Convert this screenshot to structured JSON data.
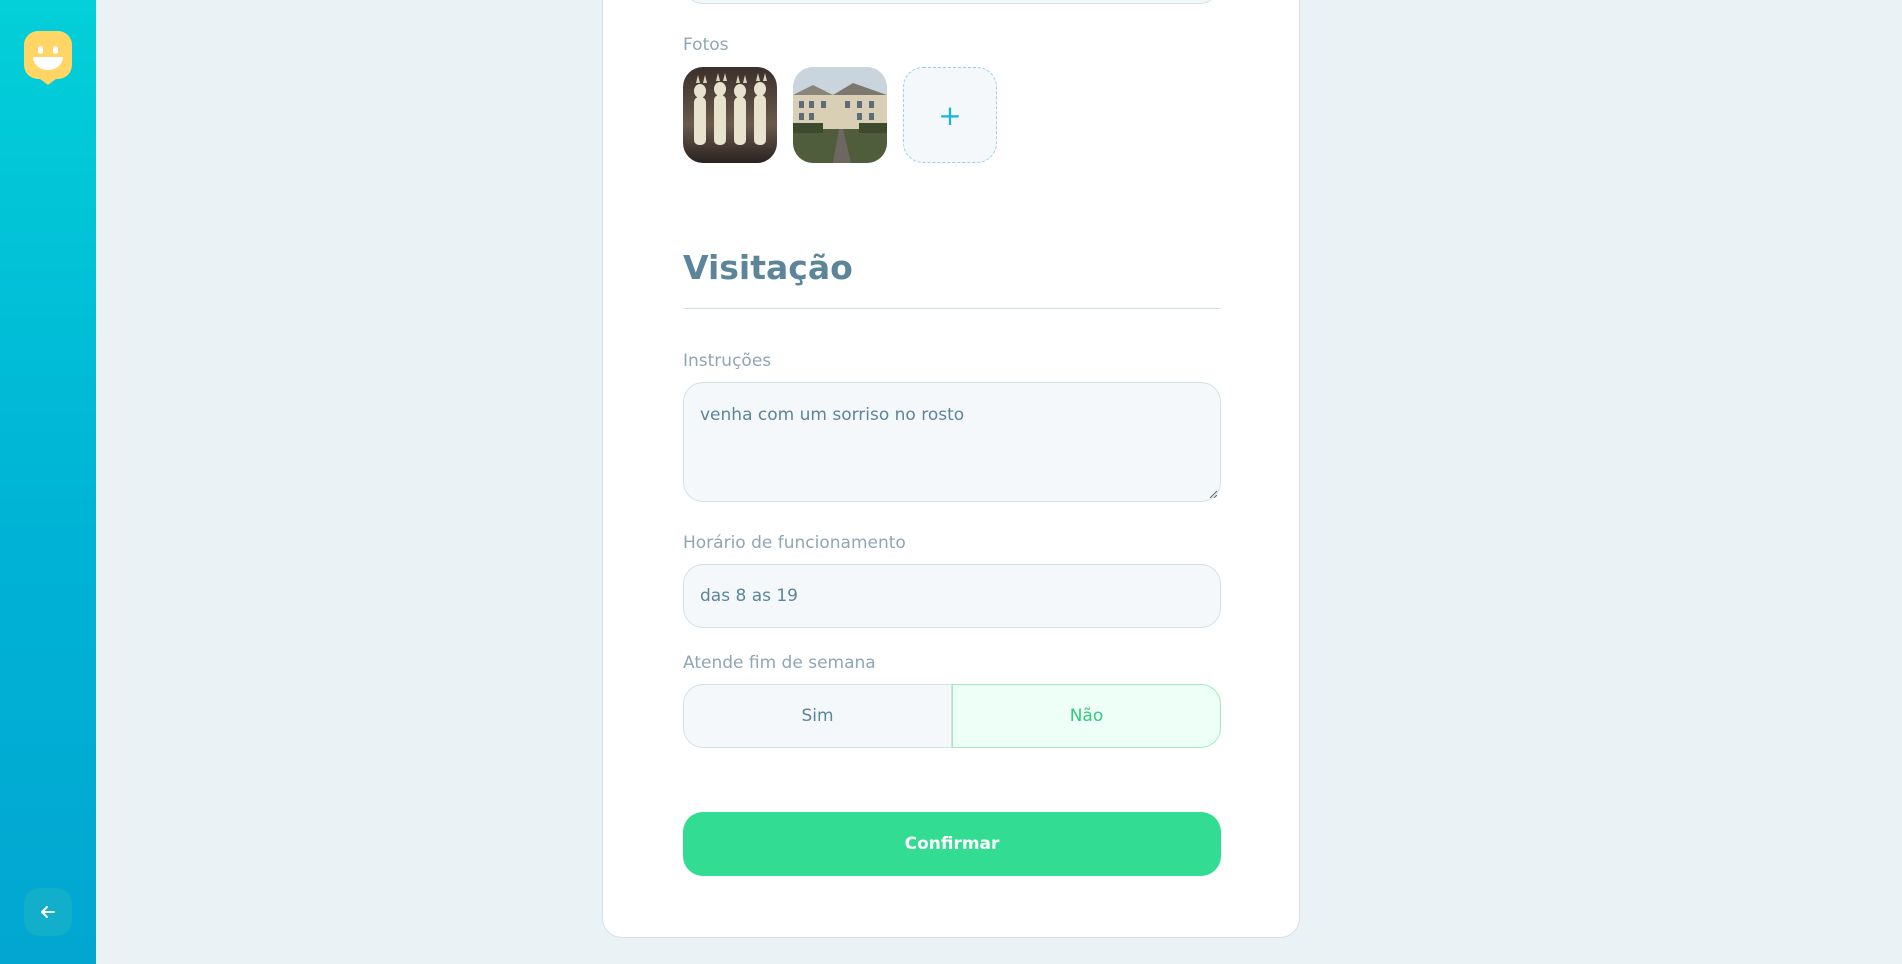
{
  "sidebar": {
    "logo_icon": "happy-face-marker-icon",
    "back_icon": "arrow-left-icon"
  },
  "form": {
    "photos_label": "Fotos",
    "add_photo_symbol": "+",
    "photos": [
      {
        "description_icon": "photo-thumbnail-people"
      },
      {
        "description_icon": "photo-thumbnail-building"
      }
    ],
    "section_title": "Visitação",
    "instructions_label": "Instruções",
    "instructions_value": "venha com um sorriso no rosto",
    "hours_label": "Horário de funcionamento",
    "hours_value": "das 8 as 19",
    "weekend_label": "Atende fim de semana",
    "weekend_yes": "Sim",
    "weekend_no": "Não",
    "weekend_selected": "Não",
    "confirm_label": "Confirmar"
  },
  "colors": {
    "accent": "#15b6d6",
    "confirm": "#32dc92",
    "selected_text": "#37c77f",
    "title": "#5c8599"
  }
}
